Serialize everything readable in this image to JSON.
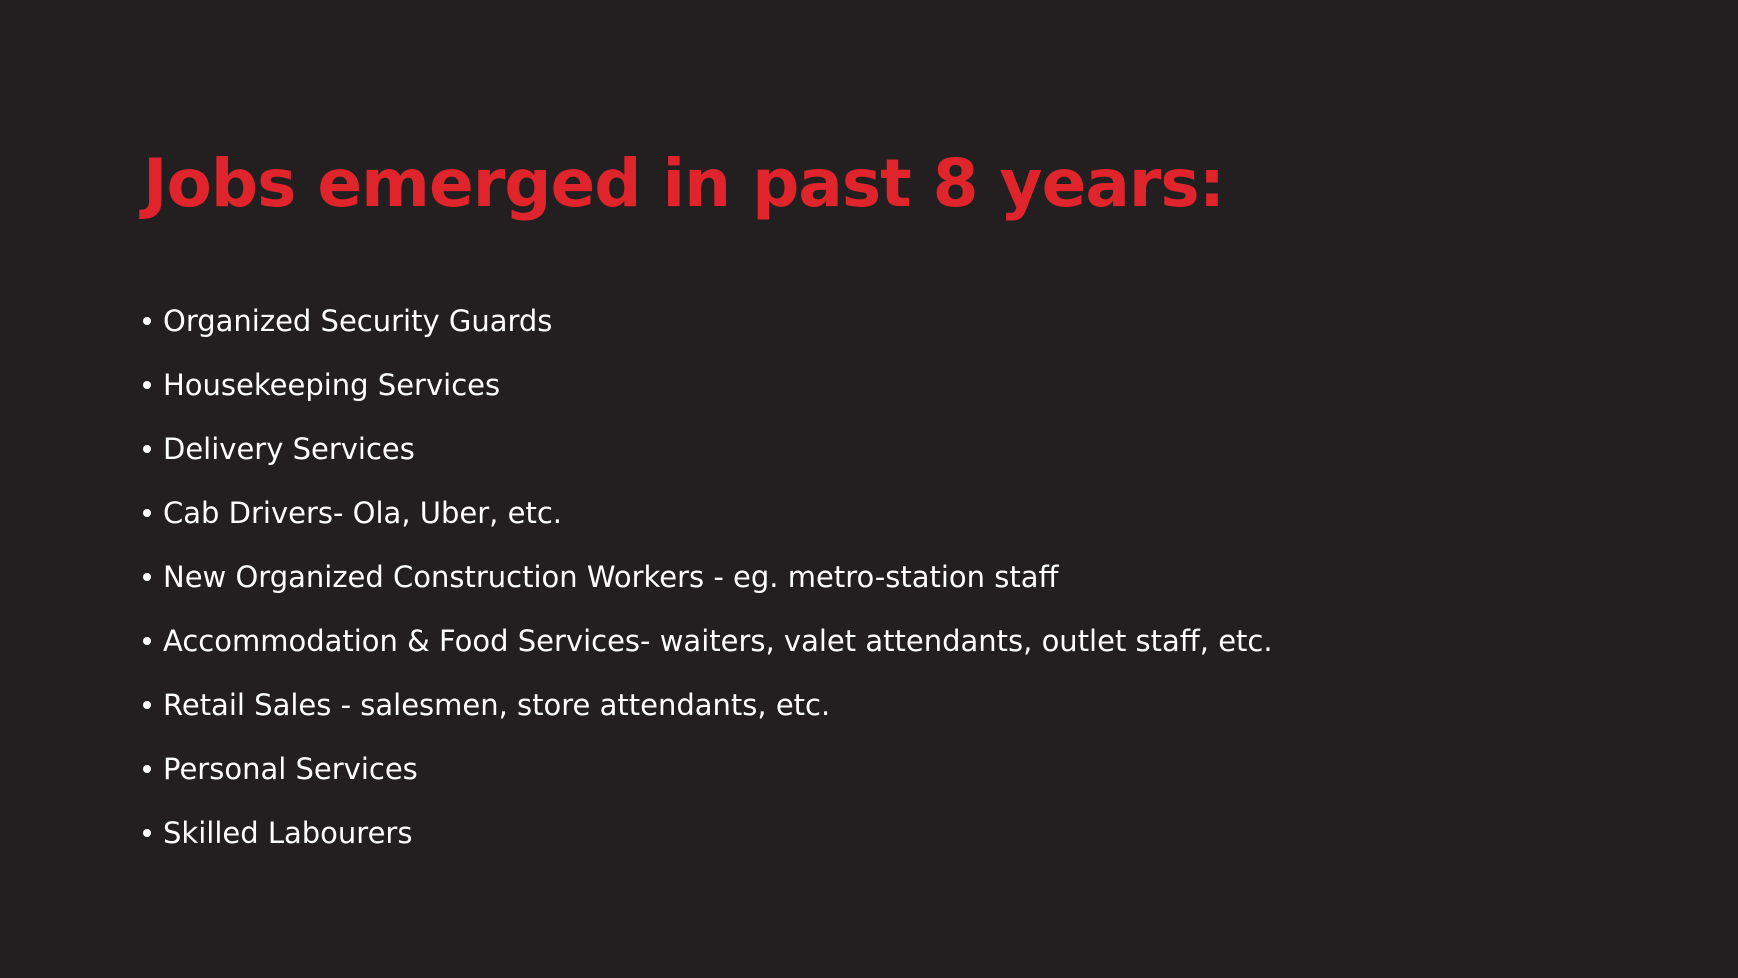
{
  "slide": {
    "title": "Jobs emerged in past 8 years:",
    "items": [
      "Organized Security Guards",
      "Housekeeping Services",
      "Delivery Services",
      "Cab Drivers- Ola, Uber, etc.",
      "New Organized Construction Workers - eg. metro-station staff",
      "Accommodation & Food Services- waiters, valet attendants, outlet staff, etc.",
      "Retail Sales - salesmen, store attendants, etc.",
      "Personal Services",
      "Skilled Labourers"
    ]
  },
  "colors": {
    "background": "#231f20",
    "title": "#e0242b",
    "text": "#ffffff"
  }
}
